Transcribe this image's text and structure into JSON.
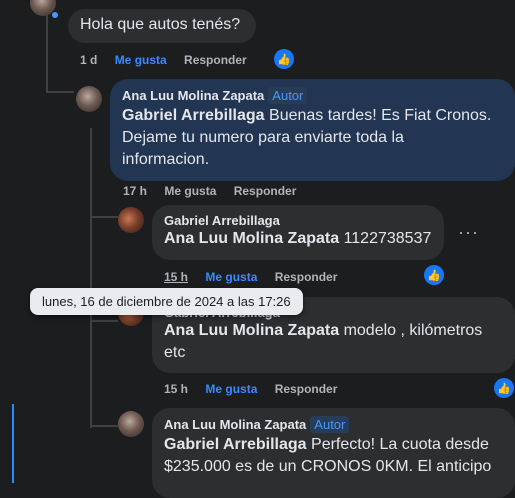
{
  "comments": [
    {
      "text": "Hola que autos tenés?",
      "time": "1 d",
      "like": "Me gusta",
      "reply": "Responder"
    },
    {
      "author": "Ana Luu Molina Zapata",
      "badge": "Autor",
      "mention": "Gabriel Arrebillaga",
      "text_line1_rest": " Buenas tardes! Es Fiat Cronos.",
      "text_line2": "Dejame tu numero para enviarte toda la",
      "text_line3": "informacion.",
      "time": "17 h",
      "like": "Me gusta",
      "reply": "Responder"
    },
    {
      "author": "Gabriel Arrebillaga",
      "mention": "Ana Luu Molina Zapata",
      "text": " 1122738537",
      "time": "15 h",
      "like": "Me gusta",
      "reply": "Responder"
    },
    {
      "author": "Gabriel Arrebillaga",
      "mention": "Ana Luu Molina Zapata",
      "text_line1_rest": " modelo , kilómetros",
      "text_line2": "etc",
      "time": "15 h",
      "like": "Me gusta",
      "reply": "Responder"
    },
    {
      "author": "Ana Luu Molina Zapata",
      "badge": "Autor",
      "mention": "Gabriel Arrebillaga",
      "text_line1_rest": " Perfecto! La cuota desde",
      "text_line2": "$235.000 es de un CRONOS 0KM. El anticipo"
    }
  ],
  "tooltip": "lunes, 16 de diciembre de 2024 a las 17:26",
  "more_options": "···",
  "colors": {
    "like": "#3b89ff",
    "badge": "#4599ff",
    "reaction": "#1877f2"
  }
}
